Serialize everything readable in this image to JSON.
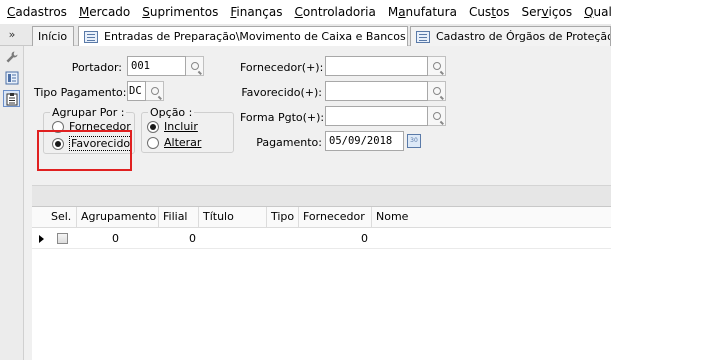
{
  "menu": [
    {
      "prefix": "",
      "hot": "C",
      "rest": "adastros"
    },
    {
      "prefix": "",
      "hot": "M",
      "rest": "ercado"
    },
    {
      "prefix": "",
      "hot": "S",
      "rest": "uprimentos"
    },
    {
      "prefix": "",
      "hot": "F",
      "rest": "inanças"
    },
    {
      "prefix": "",
      "hot": "C",
      "rest": "ontroladoria"
    },
    {
      "prefix": "M",
      "hot": "a",
      "rest": "nufatura"
    },
    {
      "prefix": "Cus",
      "hot": "t",
      "rest": "os"
    },
    {
      "prefix": "Ser",
      "hot": "v",
      "rest": "iços"
    },
    {
      "prefix": "",
      "hot": "Q",
      "rest": "ualidade"
    }
  ],
  "tabs": {
    "home": "Início",
    "entradas": "Entradas de Preparação\\Movimento de Caixa e Bancos",
    "cadastro": "Cadastro de Órgãos de Proteção a"
  },
  "toolbar": {
    "chevrons": "»",
    "tools": [
      "wrench-icon",
      "form-icon",
      "clipboard-icon"
    ]
  },
  "form": {
    "portador_label": "Portador:",
    "portador_value": "001",
    "tipo_pagamento_label": "Tipo Pagamento:",
    "tipo_pagamento_value": "DC",
    "fornecedor_label": "Fornecedor(+):",
    "fornecedor_value": "",
    "favorecido_label": "Favorecido(+):",
    "favorecido_value": "",
    "forma_pgto_label": "Forma Pgto(+):",
    "forma_pgto_value": "",
    "pagamento_label": "Pagamento:",
    "pagamento_value": "05/09/2018",
    "agrupar_title": "Agrupar Por :",
    "agrupar_options": {
      "fornecedor": "Fornecedor",
      "favorecido": "Favorecido"
    },
    "agrupar_selected": "favorecido",
    "opcao_title": "Opção :",
    "opcao_options": {
      "incluir": "Incluir",
      "alterar": "Alterar"
    },
    "opcao_selected": "incluir"
  },
  "grid": {
    "columns": [
      "Sel.",
      "Agrupamento",
      "Filial",
      "Título",
      "Tipo",
      "Fornecedor",
      "Nome"
    ],
    "rows": [
      {
        "selected": false,
        "agrupamento": "0",
        "filial": "0",
        "titulo": "",
        "tipo": "",
        "fornecedor": "0",
        "nome": ""
      }
    ]
  },
  "colors": {
    "highlight": "#e02020",
    "accent": "#5a7aa8"
  }
}
